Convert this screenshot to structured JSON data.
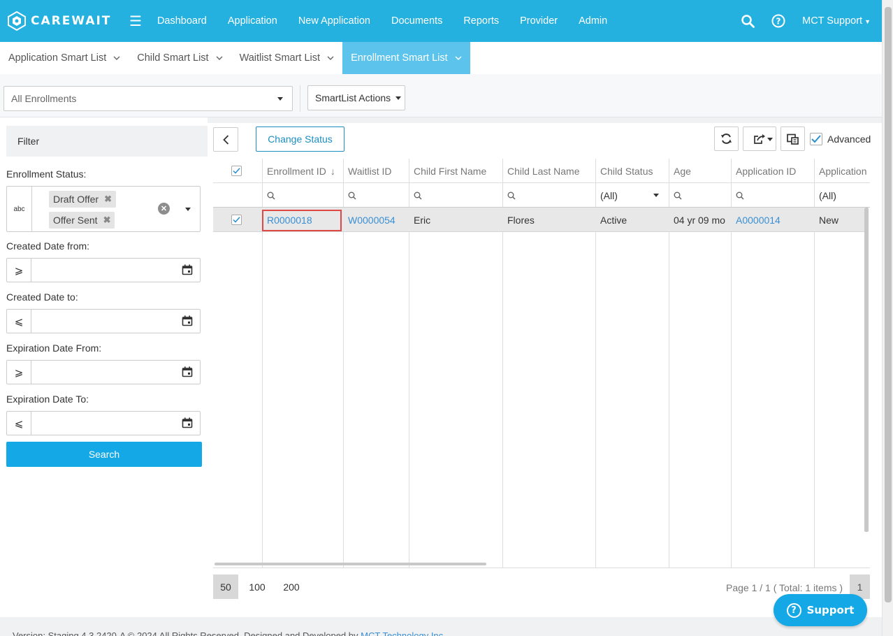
{
  "app": {
    "brand": "CAREWAIT"
  },
  "nav": {
    "items": [
      "Dashboard",
      "Application",
      "New Application",
      "Documents",
      "Reports",
      "Provider",
      "Admin"
    ],
    "user": "MCT Support"
  },
  "tabs": [
    {
      "label": "Application Smart List",
      "active": false
    },
    {
      "label": "Child Smart List",
      "active": false
    },
    {
      "label": "Waitlist Smart List",
      "active": false
    },
    {
      "label": "Enrollment Smart List",
      "active": true
    }
  ],
  "listbar": {
    "selected_list": "All Enrollments",
    "actions_label": "SmartList Actions"
  },
  "filter": {
    "title": "Filter",
    "enrollment_status_label": "Enrollment Status:",
    "abc_icon_text": "abc",
    "status_chips": [
      "Draft Offer",
      "Offer Sent"
    ],
    "created_from_label": "Created Date from:",
    "created_to_label": "Created Date to:",
    "expiration_from_label": "Expiration Date From:",
    "expiration_to_label": "Expiration Date To:",
    "gte_symbol": "⩾",
    "lte_symbol": "⩽",
    "search_label": "Search"
  },
  "toolbar": {
    "change_status_label": "Change Status",
    "advanced_label": "Advanced",
    "advanced_checked": true
  },
  "grid": {
    "columns": [
      "Enrollment ID",
      "Waitlist ID",
      "Child First Name",
      "Child Last Name",
      "Child Status",
      "Age",
      "Application ID",
      "Application"
    ],
    "sort_indicator": "↓",
    "filter_all_label": "(All)",
    "rows": [
      {
        "checked": true,
        "enrollment_id": "R0000018",
        "waitlist_id": "W0000054",
        "first_name": "Eric",
        "last_name": "Flores",
        "child_status": "Active",
        "age": "04 yr 09 mo",
        "application_id": "A0000014",
        "application_status": "New"
      }
    ]
  },
  "pager": {
    "sizes": [
      "50",
      "100",
      "200"
    ],
    "active_size": "50",
    "info": "Page 1 / 1 ( Total: 1 items )",
    "current_page": "1"
  },
  "support": {
    "label": "Support"
  },
  "footer": {
    "text": "Version: Staging 4.3.2420-A © 2024 All Rights Reserved. Designed and Developed by",
    "link": "MCT Technology Inc"
  },
  "colors": {
    "brand": "#24b1e0",
    "tab_active": "#5cc4ec",
    "primary": "#14a8e6",
    "link": "#3a8fd4",
    "highlight": "#e04848"
  }
}
